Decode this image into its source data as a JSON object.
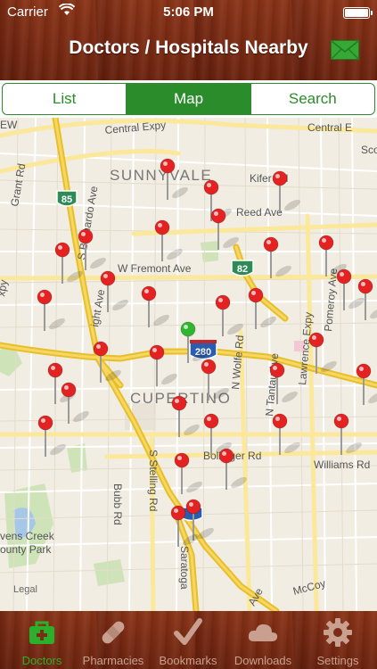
{
  "status_bar": {
    "carrier": "Carrier",
    "time": "5:06 PM"
  },
  "header": {
    "title": "Doctors / Hospitals Nearby",
    "mail_icon": "envelope-icon"
  },
  "segments": [
    {
      "label": "List",
      "active": false
    },
    {
      "label": "Map",
      "active": true
    },
    {
      "label": "Search",
      "active": false
    }
  ],
  "map": {
    "labels": {
      "central_expy": "Central Expy",
      "sunnyvale": "SUNNYVALE",
      "kifer": "Kifer Rd",
      "reed": "Reed Ave",
      "grant": "Grant Rd",
      "bernardo": "S Bernardo Ave",
      "fremont": "W Fremont Ave",
      "knight": "ight Ave",
      "cupertino": "CUPERTINO",
      "wolfe": "N Wolfe Rd",
      "tantau": "N Tantau Ave",
      "lawrence": "Lawrence Expy",
      "pomeroy": "Pomeroy Ave",
      "bubb": "Bubb Rd",
      "stelling": "S Stelling Rd",
      "bollinger": "Bollinger Rd",
      "williams": "Williams Rd",
      "saratoga": "Saratoga",
      "stevens": "vens Creek",
      "county": "ounty Park",
      "legal": "Legal",
      "mccoy": "McCoy",
      "ew": "EW",
      "expy_left": "xpy",
      "scott": "Sco",
      "central_right": "Central E",
      "ave_bottom": "Ave",
      "hwy85": "85",
      "hwy82": "82",
      "hwy280": "280"
    },
    "pin_colors": {
      "doctor": "#e42222",
      "user": "#2fb52f"
    }
  },
  "tabs": [
    {
      "label": "Doctors",
      "icon": "medical-kit-icon",
      "active": true
    },
    {
      "label": "Pharmacies",
      "icon": "bandage-icon",
      "active": false
    },
    {
      "label": "Bookmarks",
      "icon": "checkmark-icon",
      "active": false
    },
    {
      "label": "Downloads",
      "icon": "cloud-icon",
      "active": false
    },
    {
      "label": "Settings",
      "icon": "gear-icon",
      "active": false
    }
  ]
}
